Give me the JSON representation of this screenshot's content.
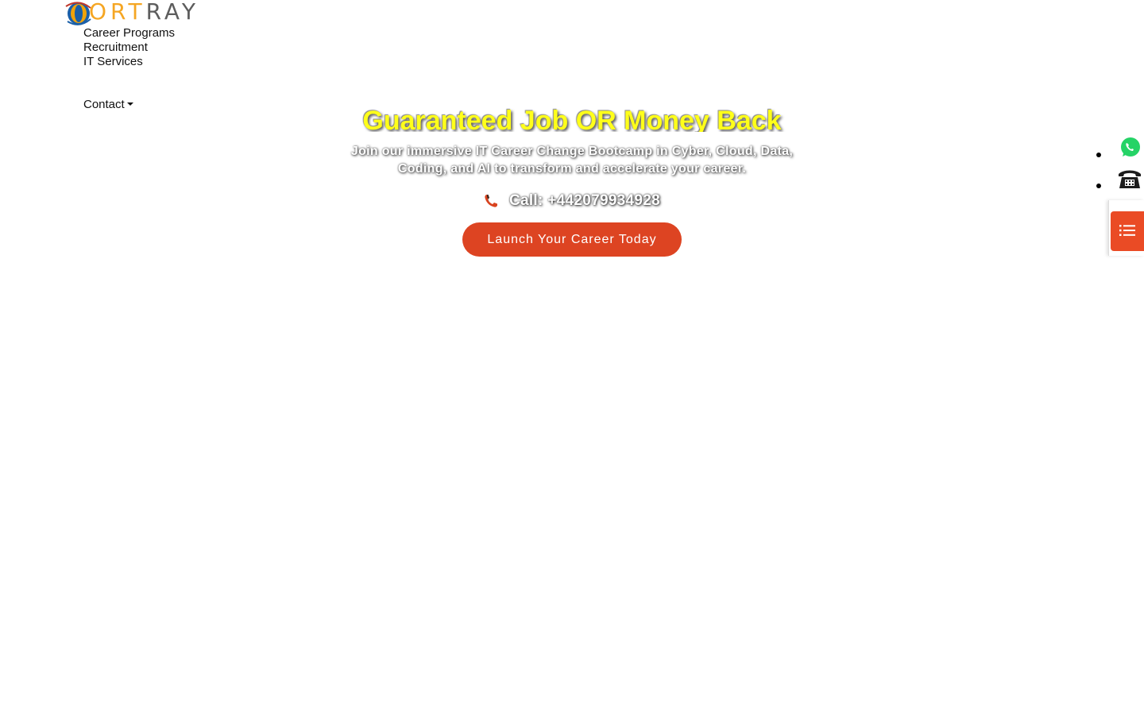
{
  "brand": {
    "logo_first": "ORT",
    "logo_rest": "RAY"
  },
  "nav": {
    "items": [
      {
        "label": "Career Programs"
      },
      {
        "label": "Recruitment"
      },
      {
        "label": "IT Services"
      },
      {
        "label": "Contact"
      }
    ]
  },
  "hero": {
    "title": "Guaranteed Job OR Money Back",
    "subtitle": "Join our immersive IT Career Change Bootcamp in Cyber, Cloud, Data, Coding, and AI to transform and accelerate your career.",
    "call": "Call: +442079934928",
    "cta_label": "Launch Your Career Today"
  },
  "floating": {
    "icons": [
      "whatsapp-icon",
      "telephone-icon",
      "list-icon"
    ]
  },
  "colors": {
    "title_yellow": "#ffff1a",
    "cta_orange": "#dd4422",
    "menu_orange": "#ea4b25",
    "whatsapp_green": "#25d366",
    "logo_fire": "#f5a623",
    "logo_grey": "#5d5d5d"
  }
}
